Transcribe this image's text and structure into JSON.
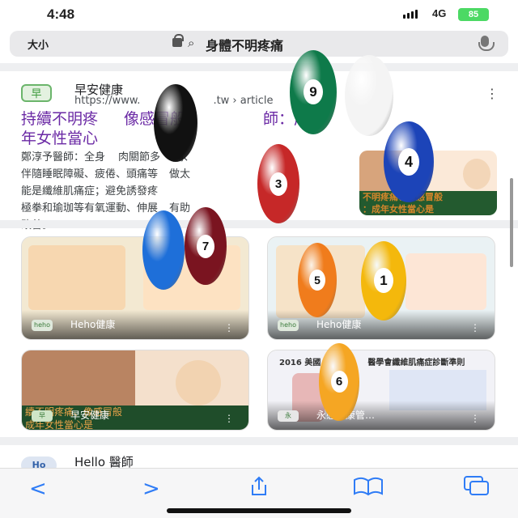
{
  "status": {
    "time": "4:48",
    "network": "4G",
    "battery": "85"
  },
  "urlbar": {
    "text_size_button": "大小",
    "query": "身體不明疼痛"
  },
  "result1": {
    "favicon": "早",
    "site_name": "早安健康",
    "url": "https://www.",
    "url_tail": ".tw › article",
    "title": "持續不明疼",
    "title_mid": "像感冒般",
    "title_end": "師：成",
    "title_line2": "年女性當心",
    "snippet_line1": "鄭淳予醫師：全身",
    "snippet_line1b": "肉關節多",
    "snippet_line1c": "痛、",
    "snippet_line2": "伴隨睡眠障礙、疲倦、頭痛等",
    "snippet_line2b": "做太",
    "snippet_line3": "能是纖維肌痛症；避免誘發疼",
    "snippet_line4": "極拳和瑜珈等有氧運動、伸展",
    "snippet_line4b": "有助",
    "snippet_line5": "改善。",
    "thumb_banner": "不明疼痛、像感冒般",
    "thumb_banner2": "：成年女性當心是"
  },
  "cards": [
    {
      "label": "Heho健康",
      "bg": "#f3e9d2"
    },
    {
      "label": "Heho健康",
      "bg": "#eaf2f4"
    },
    {
      "label": "早安健康",
      "bg": "#f4e0cc",
      "banner": "續不明疼痛、像感冒般",
      "banner2": "成年女性當心是"
    },
    {
      "label": "永感健康管…",
      "bg": "#f2f2f7",
      "banner": "2016 美國",
      "banner2": "醫學會纖維肌痛症診斷準則"
    }
  ],
  "hello": {
    "favicon": "Ho",
    "name": "Hello 醫師"
  },
  "toolbar": {
    "back": "<",
    "forward": ">"
  },
  "balls": [
    {
      "n": "9",
      "color": "#0e7a4a"
    },
    {
      "n": "",
      "color": "#f4f4f4"
    },
    {
      "n": "",
      "color": "#111111"
    },
    {
      "n": "3",
      "color": "#c62828"
    },
    {
      "n": "4",
      "color": "#1c44b8"
    },
    {
      "n": "",
      "color": "#1e6fd9"
    },
    {
      "n": "7",
      "color": "#7a1420"
    },
    {
      "n": "5",
      "color": "#f07c1c"
    },
    {
      "n": "1",
      "color": "#f4b80c"
    },
    {
      "n": "6",
      "color": "#f5a623"
    }
  ]
}
